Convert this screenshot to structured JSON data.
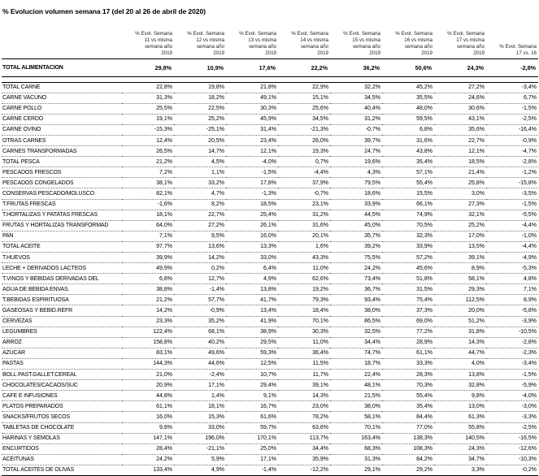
{
  "title": "% Evolucion volumen  semana 17 (del 20 al 26 de abril de 2020)",
  "headers": [
    [
      "% Evol. Semana",
      "11  vs misma",
      "semana año",
      "2019"
    ],
    [
      "% Evol. Semana",
      "12  vs misma",
      "semana año",
      "2019"
    ],
    [
      "% Evol. Semana",
      "13  vs misma",
      "semana año",
      "2019"
    ],
    [
      "% Evol. Semana",
      "14  vs misma",
      "semana año",
      "2019"
    ],
    [
      "% Evol. Semana",
      "15  vs misma",
      "semana año",
      "2019"
    ],
    [
      "% Evol. Semana",
      "16  vs misma",
      "semana año",
      "2019"
    ],
    [
      "% Evol. Semana",
      "17  vs misma",
      "semana año",
      "2019"
    ],
    [
      "% Evol. Semana",
      "17 vs. 16"
    ]
  ],
  "total_row": {
    "label": "TOTAL ALIMENTACION",
    "values": [
      "29,8%",
      "10,9%",
      "17,6%",
      "22,2%",
      "36,2%",
      "50,6%",
      "24,3%",
      "-2,8%"
    ]
  },
  "rows": [
    {
      "label": "TOTAL CARNE",
      "values": [
        "22,8%",
        "19,8%",
        "21,8%",
        "22,9%",
        "32,2%",
        "45,2%",
        "27,2%",
        "-3,4%"
      ]
    },
    {
      "label": "CARNE VACUNO",
      "values": [
        "31,3%",
        "18,2%",
        "49,1%",
        "15,1%",
        "34,5%",
        "35,5%",
        "24,6%",
        "6,7%"
      ]
    },
    {
      "label": "CARNE POLLO",
      "values": [
        "25,5%",
        "22,5%",
        "30,3%",
        "25,6%",
        "40,4%",
        "48,0%",
        "30,6%",
        "-1,5%"
      ]
    },
    {
      "label": "CARNE CERDO",
      "values": [
        "19,1%",
        "25,2%",
        "45,9%",
        "34,5%",
        "31,2%",
        "59,5%",
        "43,1%",
        "-2,5%"
      ]
    },
    {
      "label": "CARNE OVINO",
      "values": [
        "-15,3%",
        "-25,1%",
        "31,4%",
        "-21,3%",
        "-0,7%",
        "6,8%",
        "35,6%",
        "-16,4%"
      ]
    },
    {
      "label": "OTRAS CARNES",
      "values": [
        "12,4%",
        "20,5%",
        "23,4%",
        "26,0%",
        "39,7%",
        "31,6%",
        "22,7%",
        "-0,9%"
      ]
    },
    {
      "label": "CARNES TRANSFORMADAS",
      "values": [
        "26,5%",
        "14,7%",
        "12,1%",
        "19,3%",
        "24,7%",
        "43,8%",
        "12,1%",
        "-4,7%"
      ]
    },
    {
      "label": "TOTAL PESCA",
      "values": [
        "21,2%",
        "4,5%",
        "-4,0%",
        "0,7%",
        "19,6%",
        "35,4%",
        "18,5%",
        "-2,8%"
      ]
    },
    {
      "label": "PESCADOS FRESCOS",
      "values": [
        "7,2%",
        "1,1%",
        "-1,5%",
        "-4,4%",
        "4,3%",
        "57,1%",
        "21,4%",
        "-1,2%"
      ]
    },
    {
      "label": "PESCADOS CONGELADOS",
      "values": [
        "38,1%",
        "33,2%",
        "17,8%",
        "37,9%",
        "79,5%",
        "55,4%",
        "25,8%",
        "-15,8%"
      ]
    },
    {
      "label": "CONSERVAS PESCADO/MOLUSCO",
      "values": [
        "82,1%",
        "4,7%",
        "-1,3%",
        "-0,7%",
        "18,6%",
        "15,5%",
        "3,0%",
        "-3,5%"
      ]
    },
    {
      "label": "T.FRUTAS FRESCAS",
      "values": [
        "-1,6%",
        "8,2%",
        "18,5%",
        "23,1%",
        "33,9%",
        "66,1%",
        "27,3%",
        "-1,5%"
      ]
    },
    {
      "label": "T.HORTALIZAS Y PATATAS FRESCAS",
      "values": [
        "18,1%",
        "22,7%",
        "25,4%",
        "31,2%",
        "44,5%",
        "74,9%",
        "32,1%",
        "-5,5%"
      ]
    },
    {
      "label": "FRUTAS Y HORTALIZAS TRANSFORMAD",
      "values": [
        "64,0%",
        "27,2%",
        "26,1%",
        "31,6%",
        "45,0%",
        "70,5%",
        "25,2%",
        "-4,4%"
      ]
    },
    {
      "label": "PAN",
      "values": [
        "7,1%",
        "9,5%",
        "16,0%",
        "20,1%",
        "35,7%",
        "32,3%",
        "17,0%",
        "-1,0%"
      ]
    },
    {
      "label": "TOTAL ACEITE",
      "values": [
        "97,7%",
        "13,6%",
        "13,3%",
        "1,6%",
        "39,2%",
        "33,9%",
        "13,5%",
        "-4,4%"
      ]
    },
    {
      "label": "T.HUEVOS",
      "values": [
        "39,9%",
        "14,2%",
        "33,0%",
        "43,3%",
        "75,5%",
        "57,2%",
        "39,1%",
        "-4,9%"
      ]
    },
    {
      "label": "LECHE + DERIVADOS LACTEOS",
      "values": [
        "49,9%",
        "0,2%",
        "6,4%",
        "11,0%",
        "24,2%",
        "45,6%",
        "8,9%",
        "-5,3%"
      ]
    },
    {
      "label": "T.VINOS Y BEBIDAS DERIVADAS DEL",
      "values": [
        "6,8%",
        "12,7%",
        "4,9%",
        "62,6%",
        "73,4%",
        "51,8%",
        "58,1%",
        "4,8%"
      ]
    },
    {
      "label": "AGUA DE BEBIDA ENVAS.",
      "values": [
        "38,8%",
        "-1,4%",
        "13,8%",
        "19,2%",
        "36,7%",
        "31,5%",
        "29,3%",
        "7,1%"
      ]
    },
    {
      "label": "T.BEBIDAS ESPIRITUOSA",
      "values": [
        "21,2%",
        "57,7%",
        "41,7%",
        "79,3%",
        "93,4%",
        "75,4%",
        "112,5%",
        "8,9%"
      ]
    },
    {
      "label": "GASEOSAS Y BEBID.REFR",
      "values": [
        "14,2%",
        "-0,9%",
        "13,4%",
        "18,4%",
        "38,0%",
        "37,3%",
        "20,0%",
        "-5,8%"
      ]
    },
    {
      "label": "CERVEZAS",
      "values": [
        "23,3%",
        "35,2%",
        "41,9%",
        "70,1%",
        "86,5%",
        "69,0%",
        "51,2%",
        "-3,9%"
      ]
    },
    {
      "label": "LEGUMBRES",
      "values": [
        "122,4%",
        "68,1%",
        "38,9%",
        "30,3%",
        "32,5%",
        "77,2%",
        "31,8%",
        "-10,5%"
      ]
    },
    {
      "label": "ARROZ",
      "values": [
        "158,8%",
        "40,2%",
        "29,5%",
        "11,0%",
        "34,4%",
        "28,9%",
        "14,3%",
        "-2,8%"
      ]
    },
    {
      "label": "AZUCAR",
      "values": [
        "83,1%",
        "49,6%",
        "59,3%",
        "36,4%",
        "74,7%",
        "61,1%",
        "44,7%",
        "-2,3%"
      ]
    },
    {
      "label": "PASTAS",
      "values": [
        "144,3%",
        "44,6%",
        "12,5%",
        "11,5%",
        "18,7%",
        "33,3%",
        "4,0%",
        "-3,4%"
      ]
    },
    {
      "label": "BOLL.PAST.GALLET.CEREAL",
      "values": [
        "21,0%",
        "-2,4%",
        "10,7%",
        "11,7%",
        "22,4%",
        "28,3%",
        "13,8%",
        "-1,5%"
      ]
    },
    {
      "label": "CHOCOLATES/CACAOS/SUC",
      "values": [
        "20,9%",
        "17,1%",
        "29,4%",
        "39,1%",
        "48,1%",
        "70,3%",
        "32,8%",
        "-5,9%"
      ]
    },
    {
      "label": "CAFE E INFUSIONES",
      "values": [
        "44,8%",
        "1,4%",
        "9,1%",
        "14,3%",
        "21,5%",
        "55,4%",
        "9,8%",
        "-4,0%"
      ]
    },
    {
      "label": "PLATOS PREPARADOS",
      "values": [
        "61,1%",
        "18,1%",
        "16,7%",
        "23,0%",
        "38,0%",
        "35,4%",
        "13,0%",
        "-3,0%"
      ]
    },
    {
      "label": "SNACKS/FRUTOS SECOS",
      "values": [
        "16,0%",
        "15,3%",
        "61,6%",
        "78,2%",
        "58,1%",
        "84,4%",
        "61,3%",
        "-3,3%"
      ]
    },
    {
      "label": "TABLETAS DE CHOCOLATE",
      "values": [
        "9,8%",
        "33,0%",
        "59,7%",
        "63,6%",
        "70,1%",
        "77,0%",
        "55,8%",
        "-2,5%"
      ]
    },
    {
      "label": "HARINAS Y SEMOLAS",
      "values": [
        "147,1%",
        "196,0%",
        "170,1%",
        "113,7%",
        "163,4%",
        "138,3%",
        "140,5%",
        "-16,5%"
      ]
    },
    {
      "label": "ENCURTIDOS",
      "values": [
        "28,4%",
        "-21,1%",
        "25,0%",
        "34,4%",
        "68,3%",
        "108,3%",
        "24,3%",
        "-12,6%"
      ]
    },
    {
      "label": "ACEITUNAS",
      "values": [
        "24,2%",
        "5,9%",
        "17,1%",
        "35,9%",
        "31,3%",
        "84,2%",
        "34,7%",
        "-10,3%"
      ]
    },
    {
      "label": "TOTAL ACEITES DE OLIVAS",
      "values": [
        "133,4%",
        "4,9%",
        "-1,4%",
        "-12,2%",
        "29,1%",
        "29,2%",
        "3,3%",
        "-0,2%"
      ]
    }
  ]
}
